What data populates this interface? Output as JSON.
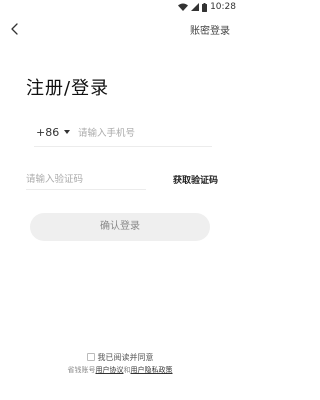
{
  "status_bar": {
    "time": "10:28",
    "icons": [
      "wifi-icon",
      "signal-icon",
      "battery-icon"
    ]
  },
  "nav": {
    "back_icon": "back-chevron-icon",
    "account_login": "账密登录"
  },
  "title": "注册/登录",
  "phone": {
    "country_code": "+86",
    "placeholder": "请输入手机号"
  },
  "code": {
    "placeholder": "请输入验证码",
    "get_code": "获取验证码"
  },
  "confirm_button": "确认登录",
  "agreement": {
    "checkbox_label": "我已阅读并同意",
    "prefix": "省钱账号",
    "user_agreement": "用户协议",
    "conjunction": "和",
    "privacy_policy": "用户隐私政策"
  },
  "colors": {
    "button_bg": "#efefef",
    "button_text": "#888888",
    "divider": "#ececec"
  }
}
